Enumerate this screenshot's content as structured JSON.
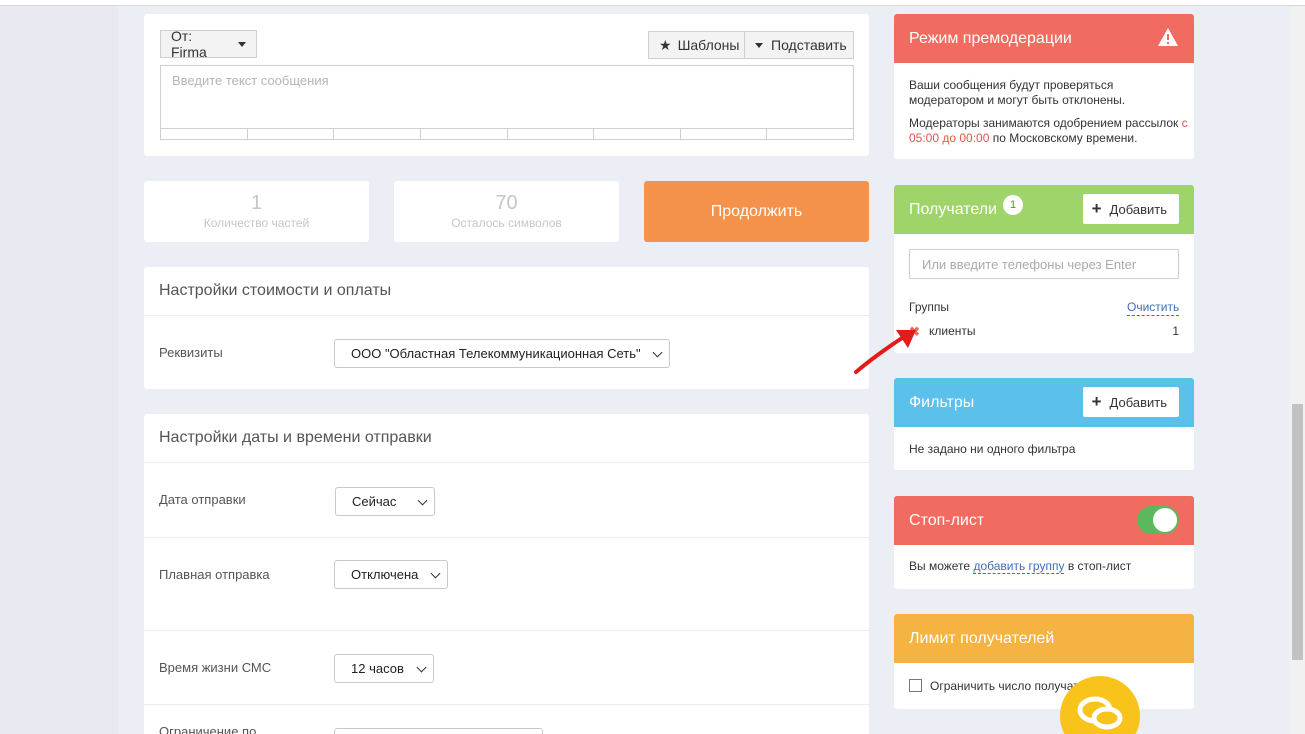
{
  "composer": {
    "from_label": "От: Firma",
    "templates_label": "Шаблоны",
    "insert_label": "Подставить",
    "message_placeholder": "Введите текст сообщения"
  },
  "stats": {
    "parts_value": "1",
    "parts_label": "Количество частей",
    "chars_value": "70",
    "chars_label": "Осталось символов",
    "continue_label": "Продолжить"
  },
  "cost_settings": {
    "title": "Настройки стоимости и оплаты",
    "requisites_label": "Реквизиты",
    "requisites_value": "ООО \"Областная Телекоммуникационная Сеть\""
  },
  "date_settings": {
    "title": "Настройки даты и времени отправки",
    "send_date_label": "Дата отправки",
    "send_date_value": "Сейчас",
    "smooth_label": "Плавная отправка",
    "smooth_value": "Отключена",
    "ttl_label": "Время жизни СМС",
    "ttl_value": "12 часов",
    "limit_label": "Ограничение по"
  },
  "premoderation": {
    "title": "Режим премодерации",
    "text1": "Ваши сообщения будут проверяться модератором и могут быть отклонены.",
    "text2_a": "Модераторы занимаются одобрением рассылок",
    "text2_time": "с 05:00 до 00:00",
    "text2_b": "по Московскому времени.",
    "accent": "#f26b60"
  },
  "recipients": {
    "title": "Получатели",
    "count": "1",
    "add_label": "Добавить",
    "phone_placeholder": "Или введите телефоны через Enter",
    "groups_label": "Группы",
    "clear_label": "Очистить",
    "group_name": "клиенты",
    "group_count": "1",
    "accent": "#9fd46a"
  },
  "filters": {
    "title": "Фильтры",
    "add_label": "Добавить",
    "empty_text": "Не задано ни одного фильтра",
    "accent": "#5bc0ea"
  },
  "stoplist": {
    "title": "Стоп-лист",
    "text_a": "Вы можете",
    "link": "добавить группу",
    "text_b": "в стоп-лист",
    "enabled": true,
    "accent": "#f26b60"
  },
  "recipient_limit": {
    "title": "Лимит получателей",
    "checkbox_label": "Ограничить число получателей",
    "accent": "#f5b342"
  }
}
